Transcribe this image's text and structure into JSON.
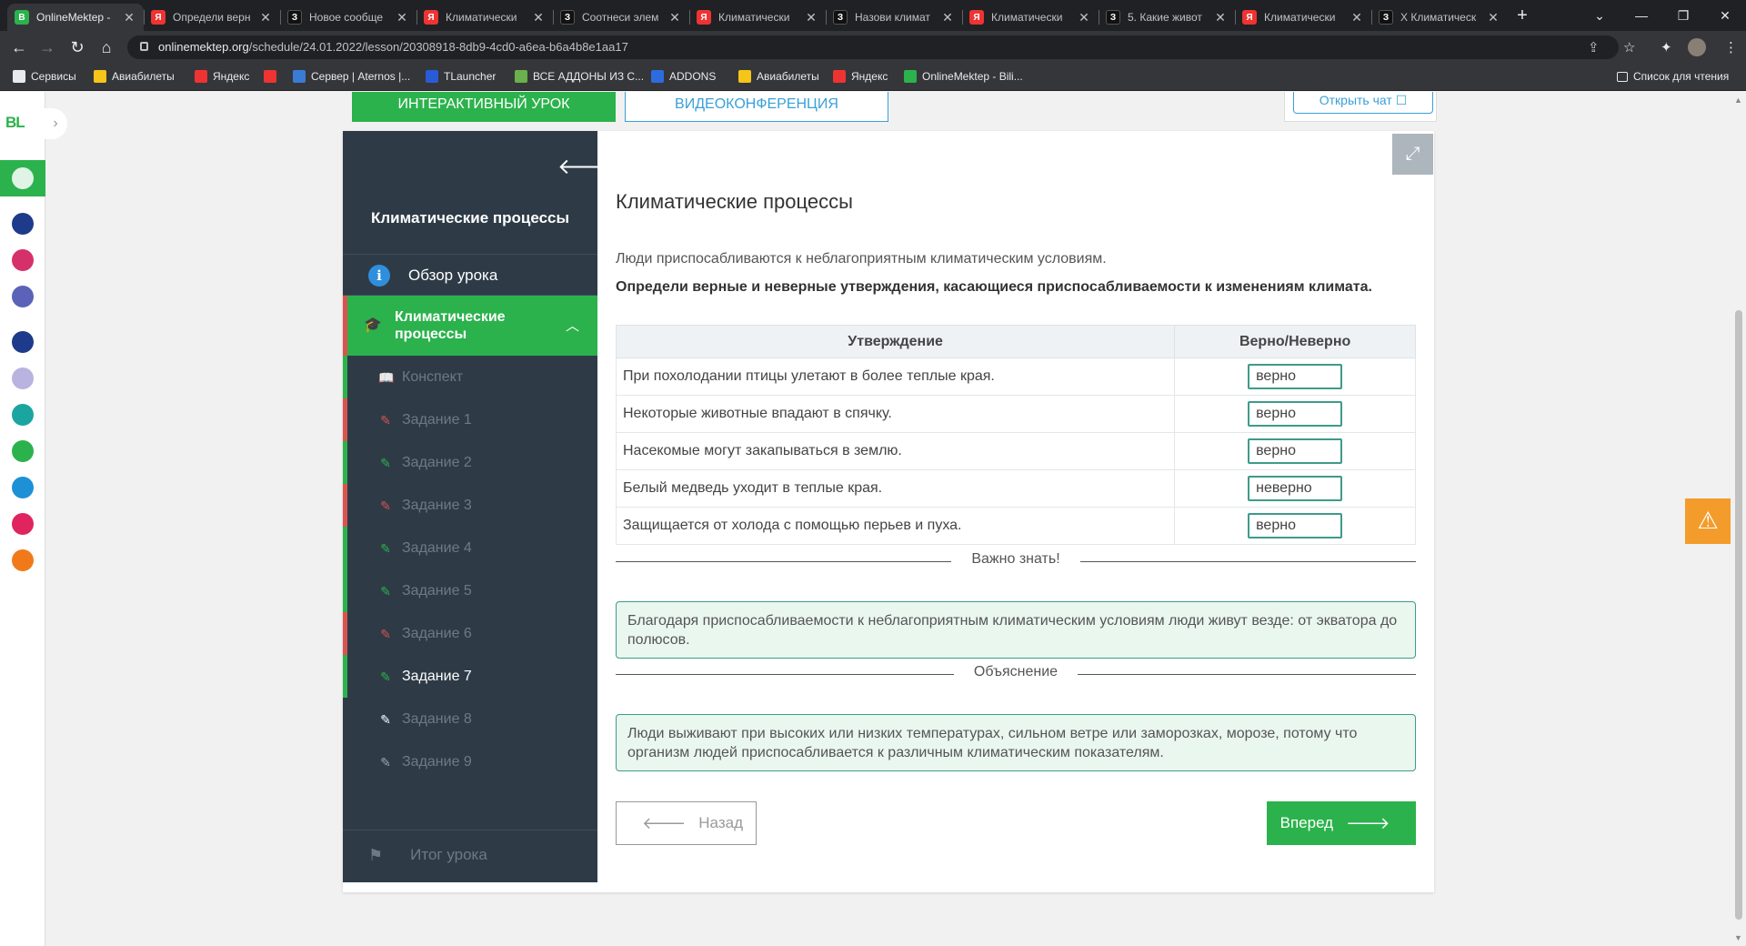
{
  "browser": {
    "tabs": [
      {
        "title": "OnlineMektep -",
        "fav": "om",
        "fav_text": "B"
      },
      {
        "title": "Определи верн",
        "fav": "ya",
        "fav_text": "Я"
      },
      {
        "title": "Новое сообще",
        "fav": "z",
        "fav_text": "З"
      },
      {
        "title": "Климатически",
        "fav": "ya",
        "fav_text": "Я"
      },
      {
        "title": "Соотнеси элем",
        "fav": "z",
        "fav_text": "З"
      },
      {
        "title": "Климатически",
        "fav": "ya",
        "fav_text": "Я"
      },
      {
        "title": "Назови климат",
        "fav": "z",
        "fav_text": "З"
      },
      {
        "title": "Климатически",
        "fav": "ya",
        "fav_text": "Я"
      },
      {
        "title": "5. Какие живот",
        "fav": "z",
        "fav_text": "З"
      },
      {
        "title": "Климатически",
        "fav": "ya",
        "fav_text": "Я"
      },
      {
        "title": "Х Климатическ",
        "fav": "z",
        "fav_text": "З"
      }
    ],
    "url_host": "onlinemektep.org",
    "url_path": "/schedule/24.01.2022/lesson/20308918-8db9-4cd0-a6ea-b6a4b8e1aa17",
    "bookmarks": [
      {
        "label": "Сервисы",
        "icon": "grid-icon"
      },
      {
        "label": "Авиабилеты",
        "icon": "plane-icon"
      },
      {
        "label": "Яндекс",
        "icon": "yandex-icon"
      },
      {
        "label": "",
        "icon": "yandex-icon"
      },
      {
        "label": "Сервер | Aternos |...",
        "icon": "aternos-icon"
      },
      {
        "label": "TLauncher",
        "icon": "tlauncher-icon"
      },
      {
        "label": "ВСЕ АДДОНЫ ИЗ С...",
        "icon": "leaf-icon"
      },
      {
        "label": "ADDONS",
        "icon": "addons-icon"
      },
      {
        "label": "Авиабилеты",
        "icon": "plane-icon"
      },
      {
        "label": "Яндекс",
        "icon": "yandex-icon"
      },
      {
        "label": "OnlineMektep - Bili...",
        "icon": "onlinemektep-icon"
      }
    ],
    "reading_list": "Список для чтения"
  },
  "header_tabs": {
    "interactive": "ИНТЕРАКТИВНЫЙ УРОК",
    "video": "ВИДЕОКОНФЕРЕНЦИЯ",
    "chat": "Открыть чат"
  },
  "sidebar": {
    "title": "Климатические процессы",
    "overview": "Обзор урока",
    "active_section": "Климатические процессы",
    "items": [
      {
        "label": "Конспект",
        "status": "ok",
        "icon": "book-icon"
      },
      {
        "label": "Задание 1",
        "status": "bad",
        "icon": "edit-icon"
      },
      {
        "label": "Задание 2",
        "status": "ok",
        "icon": "edit-icon"
      },
      {
        "label": "Задание 3",
        "status": "bad",
        "icon": "edit-icon"
      },
      {
        "label": "Задание 4",
        "status": "ok",
        "icon": "edit-icon"
      },
      {
        "label": "Задание 5",
        "status": "ok",
        "icon": "edit-icon"
      },
      {
        "label": "Задание 6",
        "status": "bad",
        "icon": "edit-icon"
      },
      {
        "label": "Задание 7",
        "status": "cur",
        "icon": "edit-icon"
      },
      {
        "label": "Задание 8",
        "status": "none",
        "icon": "edit-icon"
      },
      {
        "label": "Задание 9",
        "status": "none",
        "icon": "edit-icon"
      }
    ],
    "final": "Итог урока"
  },
  "main": {
    "title": "Климатические процессы",
    "intro": "Люди приспосабливаются к неблагоприятным климатическим условиям.",
    "task": "Определи верные и неверные утверждения, касающиеся приспосабливаемости к изменениям климата.",
    "table": {
      "headers": [
        "Утверждение",
        "Верно/Неверно"
      ],
      "rows": [
        {
          "statement": "При похолодании птицы улетают в более теплые края.",
          "value": "верно"
        },
        {
          "statement": "Некоторые животные впадают в спячку.",
          "value": "верно"
        },
        {
          "statement": "Насекомые могут закапываться в землю.",
          "value": "верно"
        },
        {
          "statement": "Белый медведь уходит в теплые края.",
          "value": "неверно"
        },
        {
          "statement": "Защищается от холода с помощью перьев и пуха.",
          "value": "верно"
        }
      ]
    },
    "important_label": "Важно знать!",
    "important_text": "Благодаря приспосабливаемости к неблагоприятным климатическим условиям люди живут везде: от экватора до полюсов.",
    "explanation_label": "Объяснение",
    "explanation_text": "Люди выживают при высоких или низких температурах, сильном ветре или заморозках, морозе, потому что организм людей приспосабливается к различным климатическим показателям.",
    "back": "Назад",
    "forward": "Вперед"
  },
  "left_rail": {
    "logo": "BL"
  },
  "colors": {
    "accent_green": "#2bb24c",
    "sidebar_bg": "#2e3b47",
    "error_red": "#d9534f",
    "link_blue": "#3aa0d8",
    "warning_orange": "#f39c2b"
  }
}
